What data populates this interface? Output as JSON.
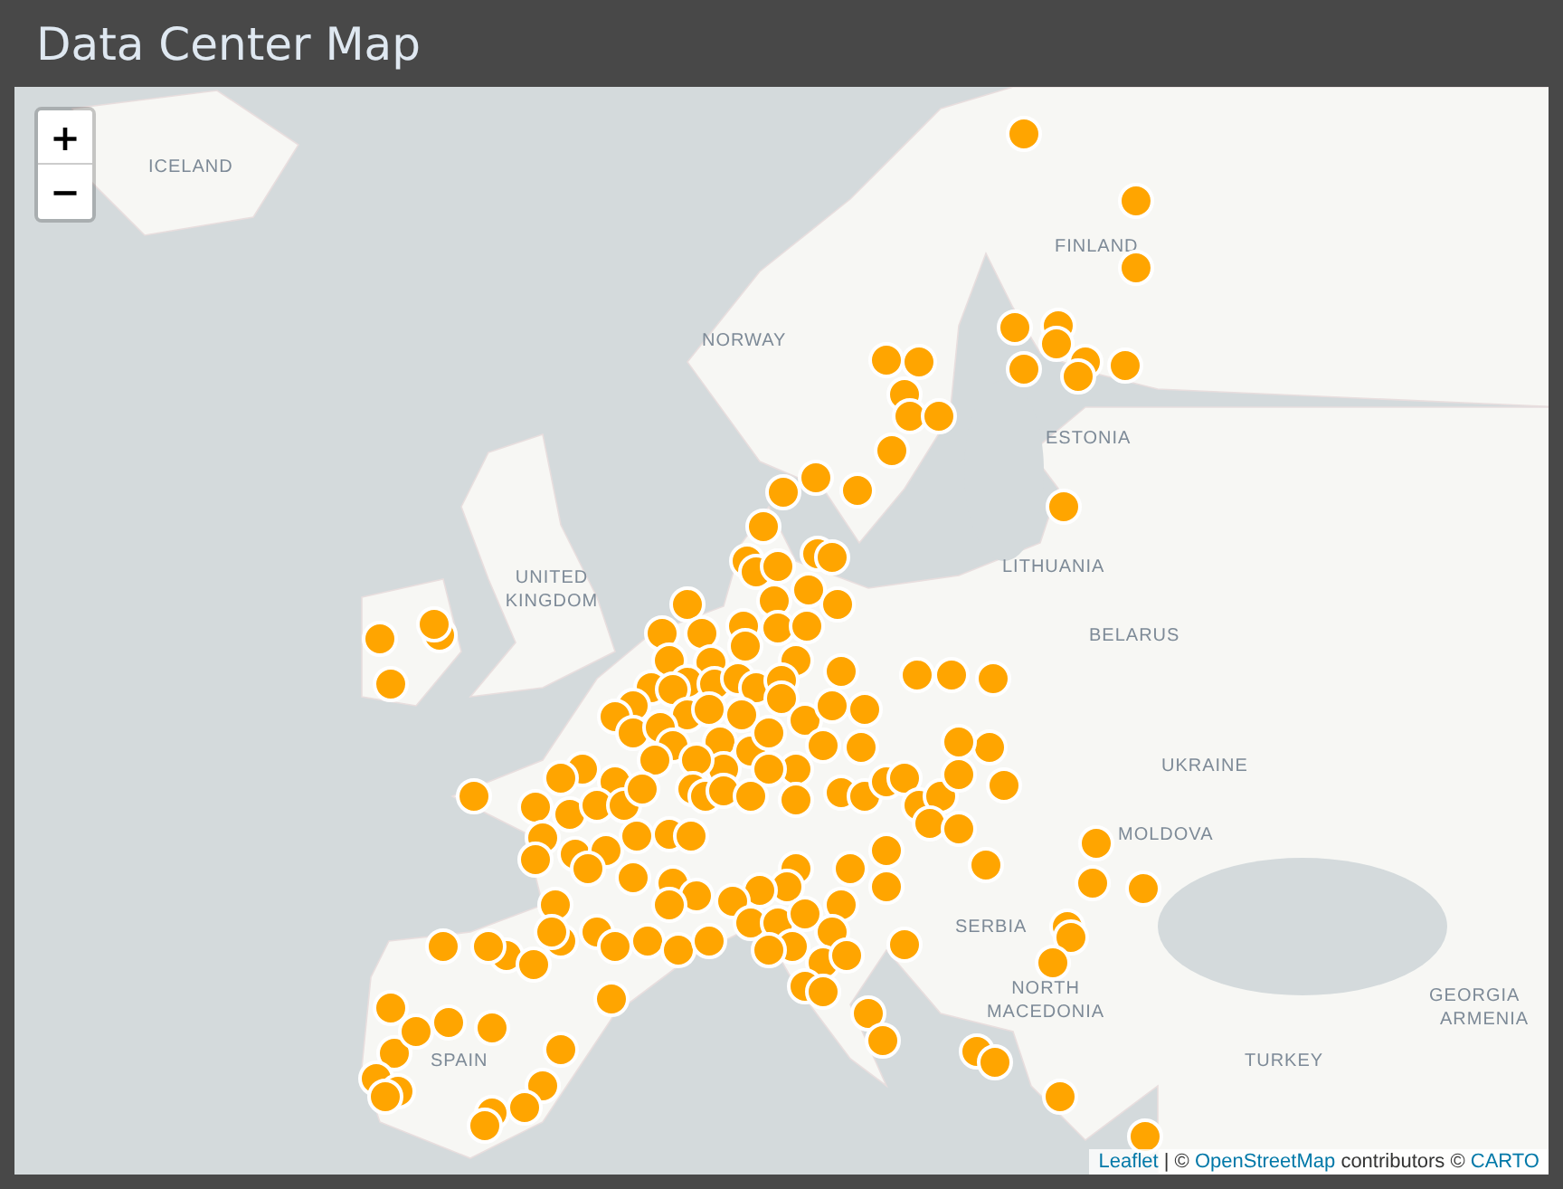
{
  "title": "Data Center Map",
  "zoom_controls": [
    {
      "kind": "zoom-in",
      "text": "+"
    },
    {
      "kind": "zoom-out",
      "text": "−"
    }
  ],
  "map_labels": [
    "ICELAND",
    "NORWAY",
    "FINLAND",
    "ESTONIA",
    "UNITED KINGDOM",
    "LITHUANIA",
    "BELARUS",
    "UKRAINE",
    "MOLDOVA",
    "SERBIA",
    "NORTH MACEDONIA",
    "GEORGIA",
    "ARMENIA",
    "SPAIN",
    "TURKEY"
  ],
  "attribution": [
    {
      "kind": "link",
      "text": "Leaflet"
    },
    {
      "kind": "text",
      "text": "| ©"
    },
    {
      "kind": "link",
      "text": "OpenStreetMap"
    },
    {
      "kind": "text",
      "text": "contributors ©"
    },
    {
      "kind": "link",
      "text": "CARTO"
    }
  ]
}
